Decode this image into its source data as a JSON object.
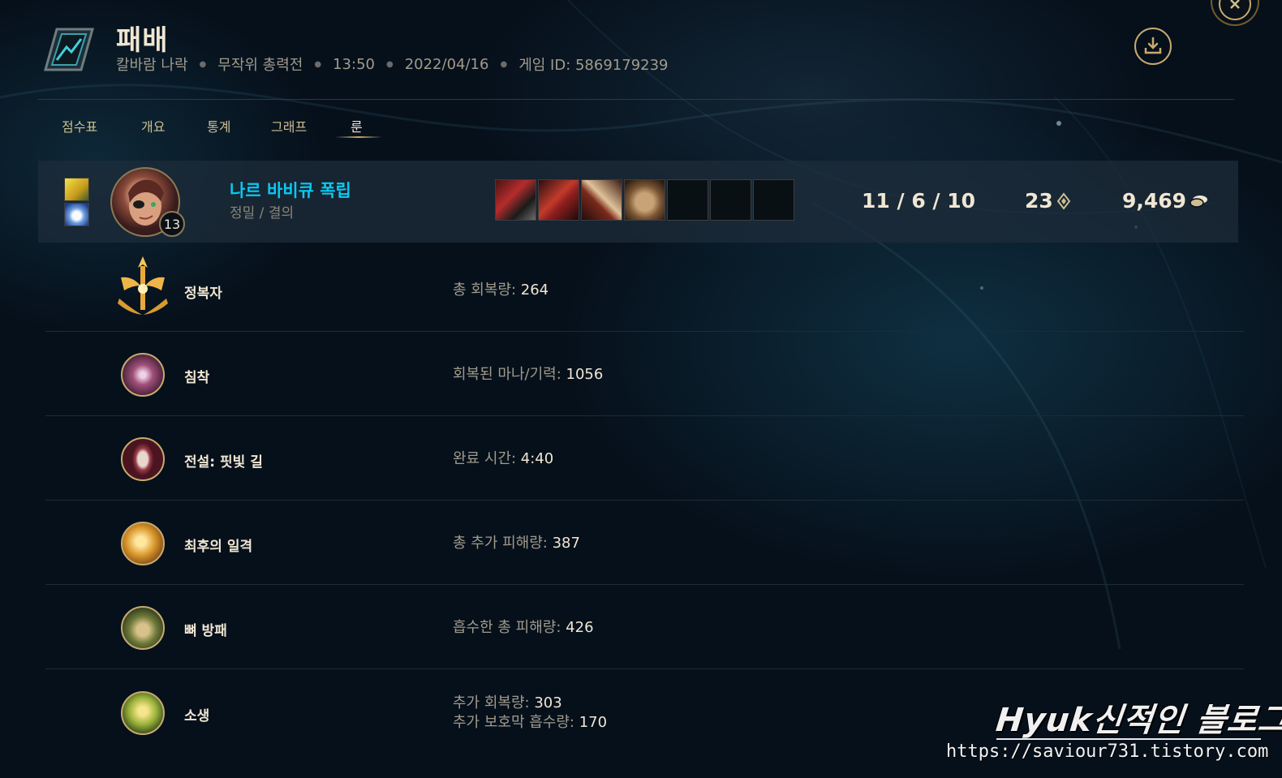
{
  "header": {
    "title": "패배",
    "map": "칼바람 나락",
    "mode": "무작위 총력전",
    "duration": "13:50",
    "date": "2022/04/16",
    "game_id": "게임 ID: 5869179239",
    "icon": "defeat-crest-icon",
    "download_icon": "download-icon",
    "close_icon": "close-icon"
  },
  "tabs": [
    {
      "label": "점수표",
      "active": false
    },
    {
      "label": "개요",
      "active": false
    },
    {
      "label": "통계",
      "active": false
    },
    {
      "label": "그래프",
      "active": false
    },
    {
      "label": "룬",
      "active": true
    }
  ],
  "player": {
    "summoner_name": "나르 바비큐 폭립",
    "rune_paths": "정밀 / 결의",
    "champion_level": "13",
    "kda": "11 / 6 / 10",
    "cs": "23",
    "gold": "9,469",
    "spells": [
      "ghost-spell-icon",
      "snowball-spell-icon"
    ],
    "items": [
      "item-1-icon",
      "item-2-icon",
      "item-3-icon",
      "boots-item-icon",
      "",
      "",
      ""
    ]
  },
  "runes": [
    {
      "name": "정복자",
      "icon": "conqueror-icon",
      "stats": [
        {
          "label": "총 회복량:",
          "value": "264"
        }
      ]
    },
    {
      "name": "침착",
      "icon": "presence-of-mind-icon",
      "stats": [
        {
          "label": "회복된 마나/기력:",
          "value": "1056"
        }
      ]
    },
    {
      "name": "전설: 핏빛 길",
      "icon": "legend-bloodline-icon",
      "stats": [
        {
          "label": "완료 시간:",
          "value": "4:40"
        }
      ]
    },
    {
      "name": "최후의 일격",
      "icon": "last-stand-icon",
      "stats": [
        {
          "label": "총 추가 피해량:",
          "value": "387"
        }
      ]
    },
    {
      "name": "뼈 방패",
      "icon": "bone-plating-icon",
      "stats": [
        {
          "label": "흡수한 총 피해량:",
          "value": "426"
        }
      ]
    },
    {
      "name": "소생",
      "icon": "revitalize-icon",
      "stats": [
        {
          "label": "추가 회복량:",
          "value": "303"
        },
        {
          "label": "추가 보호막 흡수량:",
          "value": "170"
        }
      ]
    }
  ],
  "watermark": {
    "title": "Hyuk신적인 블로그",
    "url": "https://saviour731.tistory.com"
  },
  "colors": {
    "accent_gold": "#c8aa6e",
    "summoner_blue": "#0ac8f0",
    "text_light": "#f0e6d2"
  }
}
